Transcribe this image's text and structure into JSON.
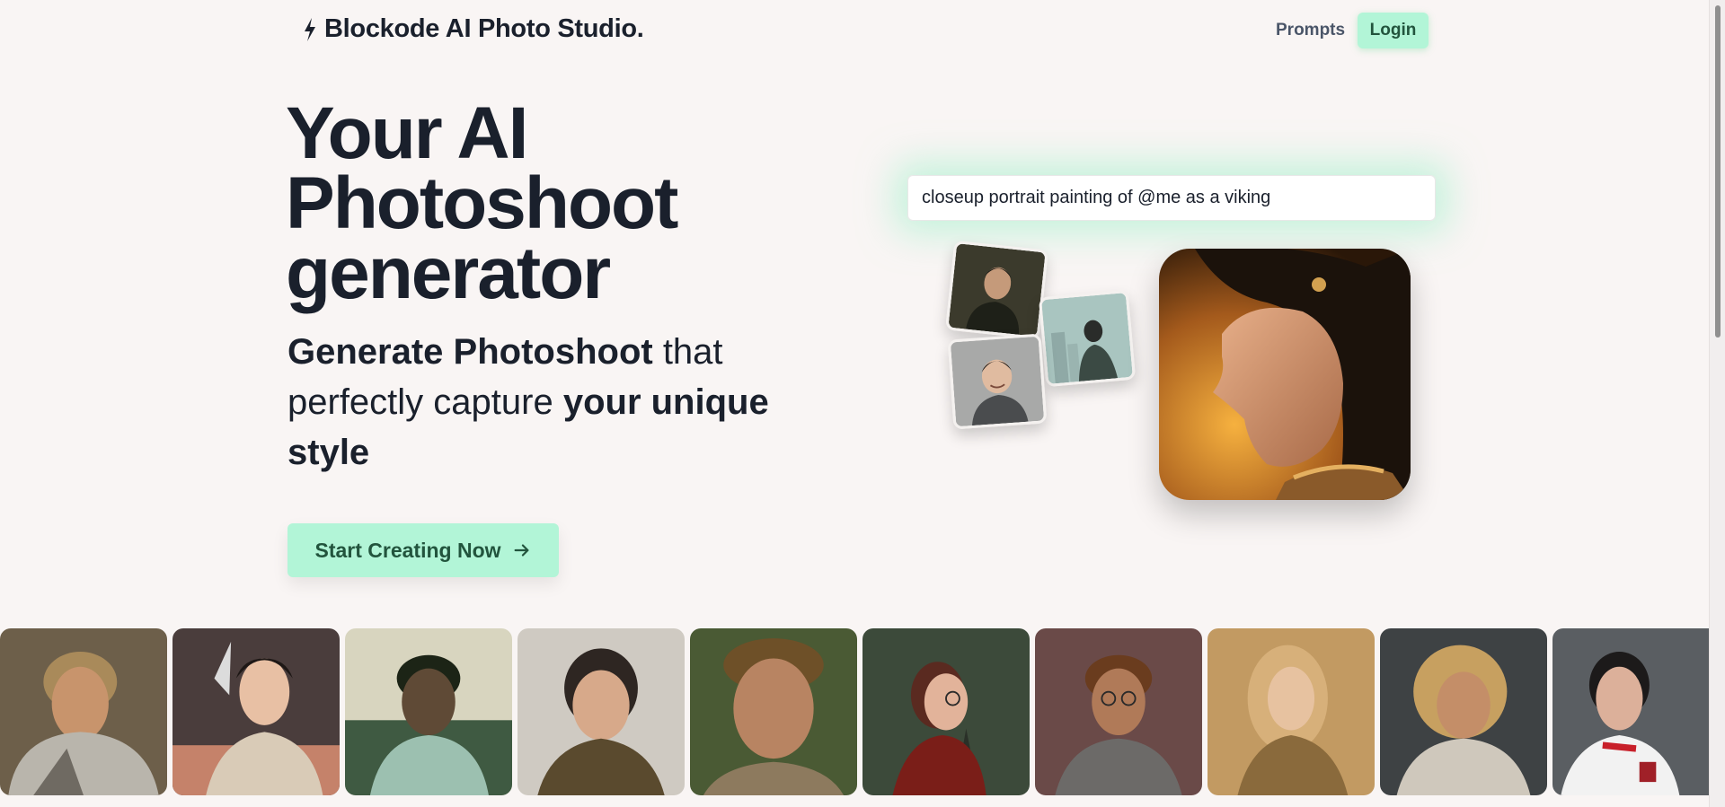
{
  "header": {
    "brand": "Blockode AI Photo Studio.",
    "nav": {
      "prompts": "Prompts",
      "login": "Login"
    }
  },
  "hero": {
    "title_lines": [
      "Your AI",
      "Photoshoot",
      "generator"
    ],
    "subtitle": {
      "part1_bold": "Generate Photoshoot",
      "part2": " that perfectly capture ",
      "part3_bold": "your unique style"
    },
    "cta_label": "Start Creating Now"
  },
  "prompt_box": {
    "value": "closeup portrait painting of @me as a viking"
  },
  "colors": {
    "accent": "#b2f5d7",
    "accent_text": "#22543d",
    "background": "#f9f5f4",
    "text": "#1a202c"
  },
  "icons": {
    "brand": "lightning-bolt-icon",
    "cta": "arrow-right-icon"
  },
  "gallery": {
    "items": [
      "viking-blond-armor",
      "woman-silver-armor",
      "green-armor-man",
      "woman-olive-jacket",
      "curly-hair-man",
      "woman-glasses-forest",
      "man-glasses-sweater",
      "elf-woman-gold",
      "curly-blond-man",
      "woman-soccer-jersey"
    ]
  }
}
